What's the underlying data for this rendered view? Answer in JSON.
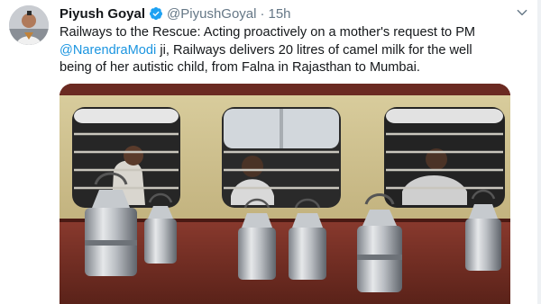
{
  "tweet": {
    "author_name": "Piyush Goyal",
    "handle": "@PiyushGoyal",
    "separator": "·",
    "time": "15h",
    "text_line1": "Railways to the Rescue: Acting proactively on a mother's request to PM",
    "mention": "@NarendraModi",
    "text_line2_rest": " ji, Railways delivers 20 litres of camel milk for the well",
    "text_line3": "being of her autistic child, from Falna in Rajasthan to Mumbai."
  },
  "icons": {
    "verified": "verified-badge-icon",
    "caret": "chevron-down-icon"
  },
  "colors": {
    "link": "#1b95e0",
    "verified": "#1da1f2",
    "muted": "#657786",
    "train_body_red": "#7a2f26",
    "train_panel_cream": "#cfc190"
  }
}
